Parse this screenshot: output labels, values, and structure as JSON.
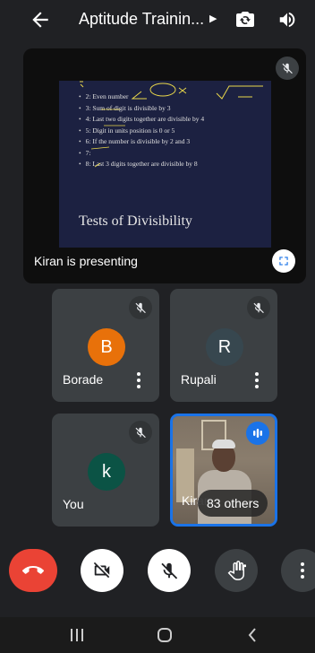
{
  "header": {
    "title": "Aptitude Trainin...",
    "icons": {
      "back": "arrow-left-icon",
      "menu": "caret-right-icon",
      "switch_camera": "switch-camera-icon",
      "audio": "speaker-icon"
    }
  },
  "presentation": {
    "presenter_label": "Kiran is presenting",
    "slide": {
      "items": [
        "2: Even number",
        "3: Sum of digit is divisible by 3",
        "4: Last two digits together are divisible by 4",
        "5: Digit in units position is 0 or 5",
        "6: If the number is divisible by 2 and 3",
        "7:",
        "8: Last 3 digits together are divisible by 8"
      ],
      "title": "Tests of Divisibility"
    },
    "icons": {
      "mute": "mic-off-icon",
      "fullscreen": "fullscreen-icon"
    }
  },
  "participants": [
    {
      "name": "Borade",
      "initial": "B",
      "avatar_color": "#e8710a",
      "muted": true
    },
    {
      "name": "Rupali",
      "initial": "R",
      "avatar_color": "#37474f",
      "muted": true
    },
    {
      "name": "You",
      "initial": "k",
      "avatar_color": "#0b5345",
      "muted": true
    },
    {
      "name": "Kiran",
      "initial": "",
      "avatar_color": "",
      "muted": false,
      "speaking": true,
      "others_label": "83 others"
    }
  ],
  "controls": {
    "end_call": "end-call-icon",
    "camera": "camera-off-icon",
    "microphone": "mic-off-icon",
    "raise_hand": "hand-icon",
    "more": "more-vert-icon"
  },
  "colors": {
    "background": "#202124",
    "tile": "#3c4043",
    "accent": "#1a73e8",
    "end_call": "#ea4335"
  },
  "system_nav": {
    "recents": "recents-icon",
    "home": "home-icon",
    "back": "nav-back-icon"
  }
}
